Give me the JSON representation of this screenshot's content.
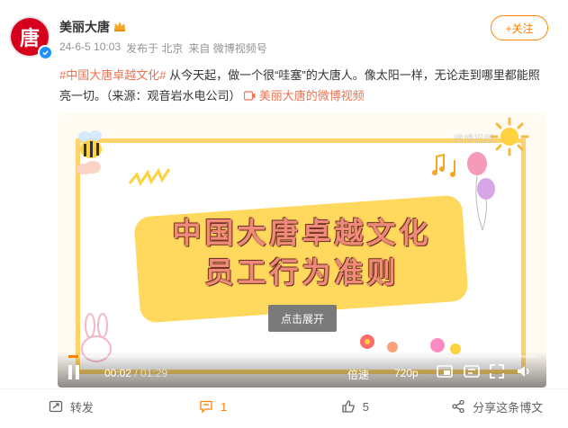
{
  "author": {
    "name": "美丽大唐",
    "avatar_char": "唐",
    "badge": "crown-icon",
    "verified": "verified-icon"
  },
  "meta": {
    "time": "24-6-5 10:03",
    "location": "发布于 北京",
    "source": "来自 微博视频号"
  },
  "follow": {
    "label": "+关注"
  },
  "post": {
    "hashtag": "#中国大唐卓越文化#",
    "text": " 从今天起，做一个很“哇塞”的大唐人。像太阳一样，无论走到哪里都能照亮一切。（来源：观音岩水电公司）",
    "link_label": "美丽大唐的微博视频",
    "link_icon": "video-link-icon"
  },
  "video": {
    "title_line1": "中国大唐卓越文化",
    "title_line2": "员工行为准则",
    "expand_label": "点击展开",
    "watermark": "微博视频",
    "current_time": "00:02",
    "total_time": "/ 01:29",
    "progress": 0.022,
    "speed_label": "倍速",
    "quality_label": "720p"
  },
  "actions": {
    "repost": "转发",
    "comment": "1",
    "like": "5",
    "share": "分享这条博文"
  },
  "colors": {
    "accent": "#ff8200",
    "link": "#eb7350",
    "brand_red": "#d6001c"
  }
}
